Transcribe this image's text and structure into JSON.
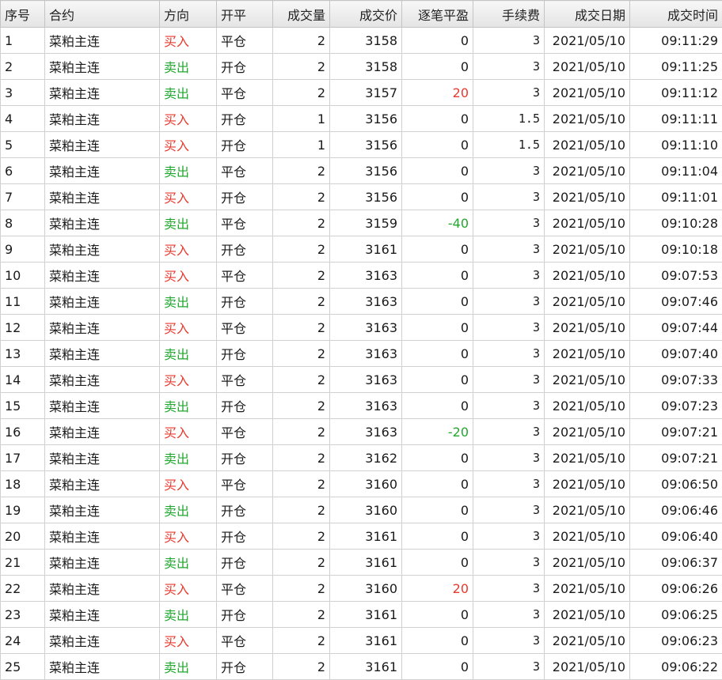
{
  "table": {
    "columns": [
      {
        "key": "no",
        "label": "序号",
        "align": "left"
      },
      {
        "key": "contract",
        "label": "合约",
        "align": "left"
      },
      {
        "key": "direction",
        "label": "方向",
        "align": "left"
      },
      {
        "key": "offset",
        "label": "开平",
        "align": "left"
      },
      {
        "key": "volume",
        "label": "成交量",
        "align": "right"
      },
      {
        "key": "price",
        "label": "成交价",
        "align": "right"
      },
      {
        "key": "pnl",
        "label": "逐笔平盈",
        "align": "right"
      },
      {
        "key": "fee",
        "label": "手续费",
        "align": "right"
      },
      {
        "key": "date",
        "label": "成交日期",
        "align": "right"
      },
      {
        "key": "time",
        "label": "成交时间",
        "align": "right"
      }
    ],
    "rows": [
      {
        "no": "1",
        "contract": "菜粕主连",
        "direction": "买入",
        "offset": "平仓",
        "volume": "2",
        "price": "3158",
        "pnl": "0",
        "fee": "3",
        "date": "2021/05/10",
        "time": "09:11:29"
      },
      {
        "no": "2",
        "contract": "菜粕主连",
        "direction": "卖出",
        "offset": "开仓",
        "volume": "2",
        "price": "3158",
        "pnl": "0",
        "fee": "3",
        "date": "2021/05/10",
        "time": "09:11:25"
      },
      {
        "no": "3",
        "contract": "菜粕主连",
        "direction": "卖出",
        "offset": "平仓",
        "volume": "2",
        "price": "3157",
        "pnl": "20",
        "fee": "3",
        "date": "2021/05/10",
        "time": "09:11:12"
      },
      {
        "no": "4",
        "contract": "菜粕主连",
        "direction": "买入",
        "offset": "开仓",
        "volume": "1",
        "price": "3156",
        "pnl": "0",
        "fee": "1.5",
        "date": "2021/05/10",
        "time": "09:11:11"
      },
      {
        "no": "5",
        "contract": "菜粕主连",
        "direction": "买入",
        "offset": "开仓",
        "volume": "1",
        "price": "3156",
        "pnl": "0",
        "fee": "1.5",
        "date": "2021/05/10",
        "time": "09:11:10"
      },
      {
        "no": "6",
        "contract": "菜粕主连",
        "direction": "卖出",
        "offset": "平仓",
        "volume": "2",
        "price": "3156",
        "pnl": "0",
        "fee": "3",
        "date": "2021/05/10",
        "time": "09:11:04"
      },
      {
        "no": "7",
        "contract": "菜粕主连",
        "direction": "买入",
        "offset": "开仓",
        "volume": "2",
        "price": "3156",
        "pnl": "0",
        "fee": "3",
        "date": "2021/05/10",
        "time": "09:11:01"
      },
      {
        "no": "8",
        "contract": "菜粕主连",
        "direction": "卖出",
        "offset": "平仓",
        "volume": "2",
        "price": "3159",
        "pnl": "-40",
        "fee": "3",
        "date": "2021/05/10",
        "time": "09:10:28"
      },
      {
        "no": "9",
        "contract": "菜粕主连",
        "direction": "买入",
        "offset": "开仓",
        "volume": "2",
        "price": "3161",
        "pnl": "0",
        "fee": "3",
        "date": "2021/05/10",
        "time": "09:10:18"
      },
      {
        "no": "10",
        "contract": "菜粕主连",
        "direction": "买入",
        "offset": "平仓",
        "volume": "2",
        "price": "3163",
        "pnl": "0",
        "fee": "3",
        "date": "2021/05/10",
        "time": "09:07:53"
      },
      {
        "no": "11",
        "contract": "菜粕主连",
        "direction": "卖出",
        "offset": "开仓",
        "volume": "2",
        "price": "3163",
        "pnl": "0",
        "fee": "3",
        "date": "2021/05/10",
        "time": "09:07:46"
      },
      {
        "no": "12",
        "contract": "菜粕主连",
        "direction": "买入",
        "offset": "平仓",
        "volume": "2",
        "price": "3163",
        "pnl": "0",
        "fee": "3",
        "date": "2021/05/10",
        "time": "09:07:44"
      },
      {
        "no": "13",
        "contract": "菜粕主连",
        "direction": "卖出",
        "offset": "开仓",
        "volume": "2",
        "price": "3163",
        "pnl": "0",
        "fee": "3",
        "date": "2021/05/10",
        "time": "09:07:40"
      },
      {
        "no": "14",
        "contract": "菜粕主连",
        "direction": "买入",
        "offset": "平仓",
        "volume": "2",
        "price": "3163",
        "pnl": "0",
        "fee": "3",
        "date": "2021/05/10",
        "time": "09:07:33"
      },
      {
        "no": "15",
        "contract": "菜粕主连",
        "direction": "卖出",
        "offset": "开仓",
        "volume": "2",
        "price": "3163",
        "pnl": "0",
        "fee": "3",
        "date": "2021/05/10",
        "time": "09:07:23"
      },
      {
        "no": "16",
        "contract": "菜粕主连",
        "direction": "买入",
        "offset": "平仓",
        "volume": "2",
        "price": "3163",
        "pnl": "-20",
        "fee": "3",
        "date": "2021/05/10",
        "time": "09:07:21"
      },
      {
        "no": "17",
        "contract": "菜粕主连",
        "direction": "卖出",
        "offset": "开仓",
        "volume": "2",
        "price": "3162",
        "pnl": "0",
        "fee": "3",
        "date": "2021/05/10",
        "time": "09:07:21"
      },
      {
        "no": "18",
        "contract": "菜粕主连",
        "direction": "买入",
        "offset": "平仓",
        "volume": "2",
        "price": "3160",
        "pnl": "0",
        "fee": "3",
        "date": "2021/05/10",
        "time": "09:06:50"
      },
      {
        "no": "19",
        "contract": "菜粕主连",
        "direction": "卖出",
        "offset": "开仓",
        "volume": "2",
        "price": "3160",
        "pnl": "0",
        "fee": "3",
        "date": "2021/05/10",
        "time": "09:06:46"
      },
      {
        "no": "20",
        "contract": "菜粕主连",
        "direction": "买入",
        "offset": "开仓",
        "volume": "2",
        "price": "3161",
        "pnl": "0",
        "fee": "3",
        "date": "2021/05/10",
        "time": "09:06:40"
      },
      {
        "no": "21",
        "contract": "菜粕主连",
        "direction": "卖出",
        "offset": "开仓",
        "volume": "2",
        "price": "3161",
        "pnl": "0",
        "fee": "3",
        "date": "2021/05/10",
        "time": "09:06:37"
      },
      {
        "no": "22",
        "contract": "菜粕主连",
        "direction": "买入",
        "offset": "平仓",
        "volume": "2",
        "price": "3160",
        "pnl": "20",
        "fee": "3",
        "date": "2021/05/10",
        "time": "09:06:26"
      },
      {
        "no": "23",
        "contract": "菜粕主连",
        "direction": "卖出",
        "offset": "开仓",
        "volume": "2",
        "price": "3161",
        "pnl": "0",
        "fee": "3",
        "date": "2021/05/10",
        "time": "09:06:25"
      },
      {
        "no": "24",
        "contract": "菜粕主连",
        "direction": "买入",
        "offset": "平仓",
        "volume": "2",
        "price": "3161",
        "pnl": "0",
        "fee": "3",
        "date": "2021/05/10",
        "time": "09:06:23"
      },
      {
        "no": "25",
        "contract": "菜粕主连",
        "direction": "卖出",
        "offset": "开仓",
        "volume": "2",
        "price": "3161",
        "pnl": "0",
        "fee": "3",
        "date": "2021/05/10",
        "time": "09:06:22"
      }
    ]
  },
  "colors": {
    "buy": "#e8392e",
    "sell": "#22a82f",
    "pnl_positive": "#e8392e",
    "pnl_negative": "#22a82f"
  }
}
